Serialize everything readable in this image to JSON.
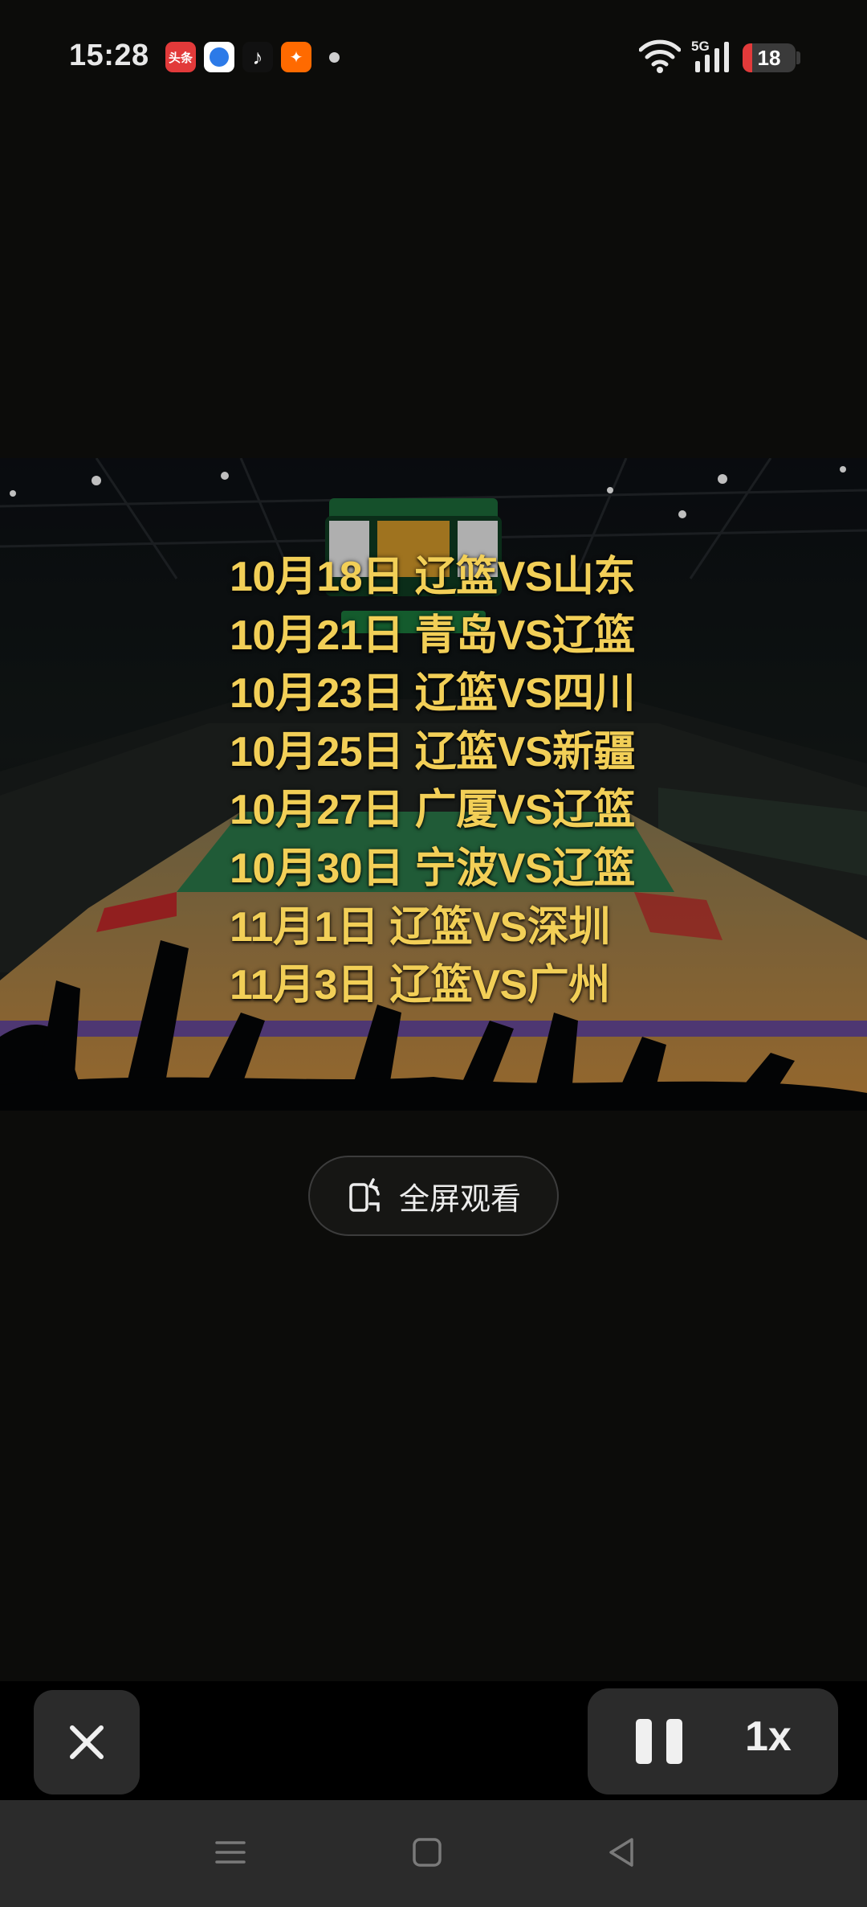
{
  "status_bar": {
    "time": "15:28",
    "network_label": "5G",
    "battery_percent": "18",
    "battery_level": 0.18,
    "notification_icons": [
      "toutiao-app-icon",
      "browser-app-icon",
      "tiktok-app-icon",
      "xigua-app-icon"
    ],
    "notif_label_1": "头条"
  },
  "video": {
    "schedule": [
      "10月18日 辽篮VS山东",
      "10月21日 青岛VS辽篮",
      "10月23日 辽篮VS四川",
      "10月25日 辽篮VS新疆",
      "10月27日 广厦VS辽篮",
      "10月30日 宁波VS辽篮",
      "11月1日  辽篮VS深圳",
      "11月3日  辽篮VS广州"
    ],
    "text_color": "#f2cf57"
  },
  "fullscreen_button": {
    "label": "全屏观看"
  },
  "player_controls": {
    "speed": "1x"
  },
  "nav_bar": {
    "items": [
      "menu-icon",
      "home-icon",
      "back-icon"
    ]
  }
}
